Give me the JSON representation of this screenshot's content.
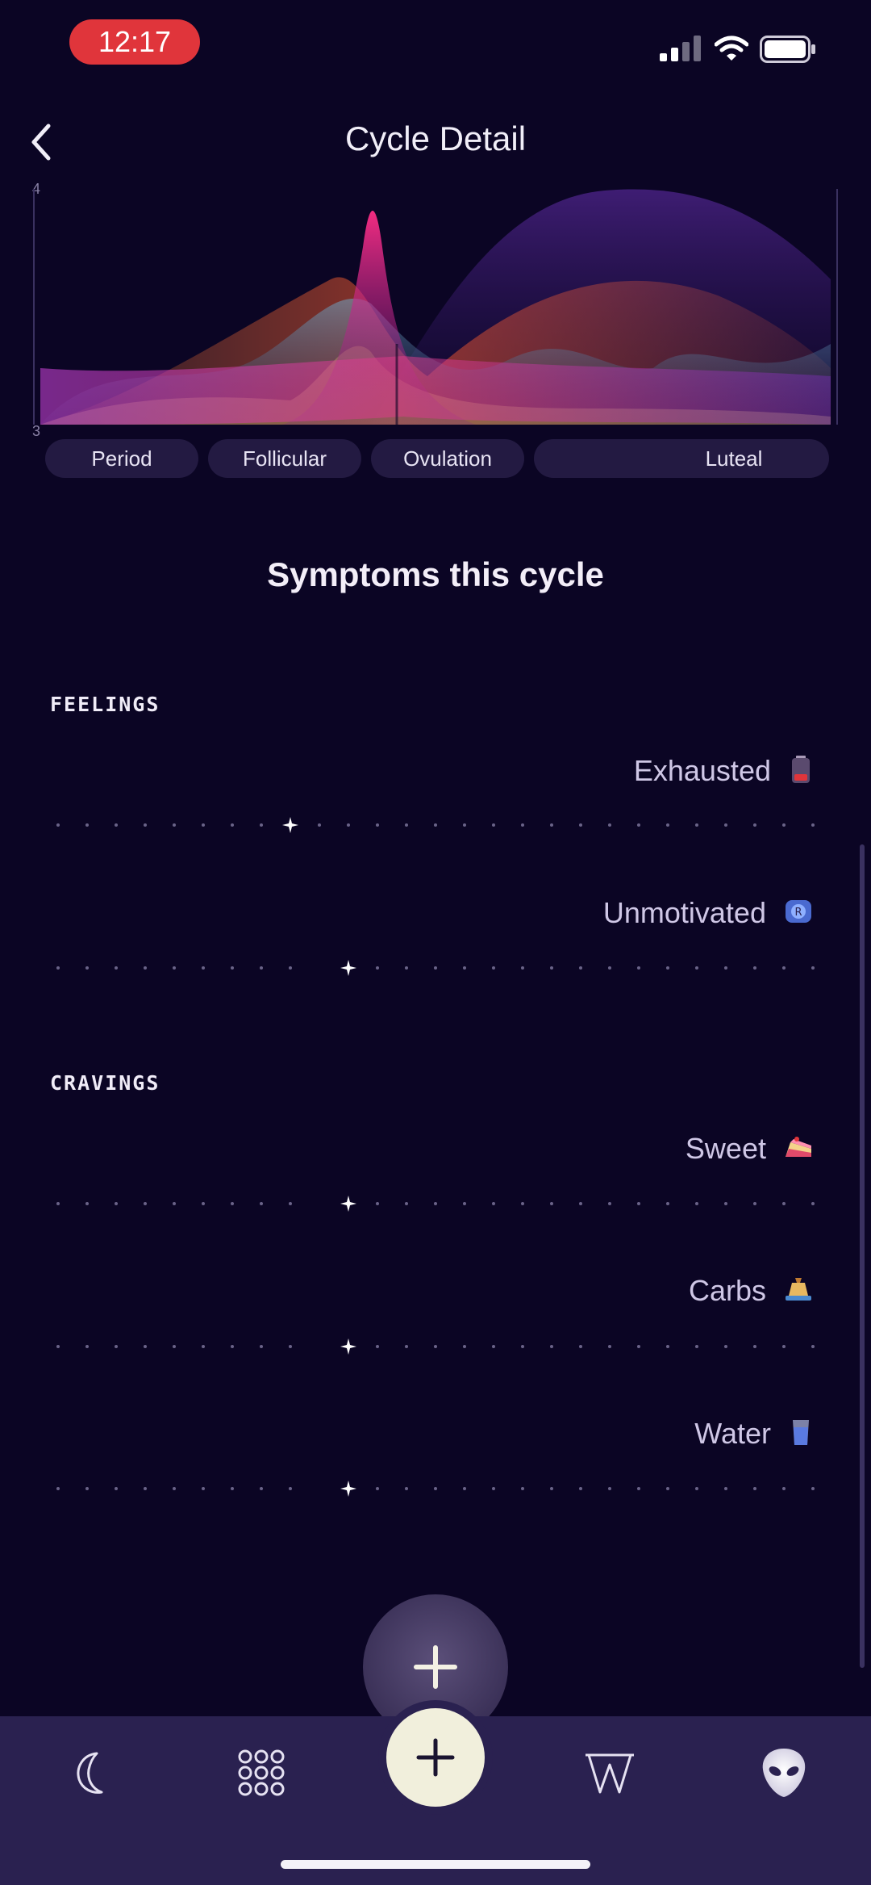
{
  "status_bar": {
    "time": "12:17"
  },
  "header": {
    "title": "Cycle Detail"
  },
  "chart_data": {
    "type": "area",
    "y_ticks": [
      "4",
      "3"
    ],
    "phases": [
      "Period",
      "Follicular",
      "Ovulation",
      "Luteal"
    ],
    "colors": [
      "#f2317f",
      "#ff6a3d",
      "#6fa8c8",
      "#d8c070",
      "#8a2fd0",
      "#c040d0"
    ]
  },
  "main": {
    "section_title": "Symptoms this cycle",
    "groups": [
      {
        "title": "FEELINGS",
        "items": [
          {
            "label": "Exhausted",
            "icon": "battery-emoji-icon"
          },
          {
            "label": "Unmotivated",
            "icon": "unmotivated-emoji-icon"
          }
        ]
      },
      {
        "title": "CRAVINGS",
        "items": [
          {
            "label": "Sweet",
            "icon": "cake-emoji-icon"
          },
          {
            "label": "Carbs",
            "icon": "carbs-emoji-icon"
          },
          {
            "label": "Water",
            "icon": "water-glass-emoji-icon"
          }
        ]
      }
    ]
  },
  "nav": {
    "items": [
      "moon-icon",
      "grid-icon",
      "add-icon",
      "w-icon",
      "alien-icon"
    ]
  }
}
